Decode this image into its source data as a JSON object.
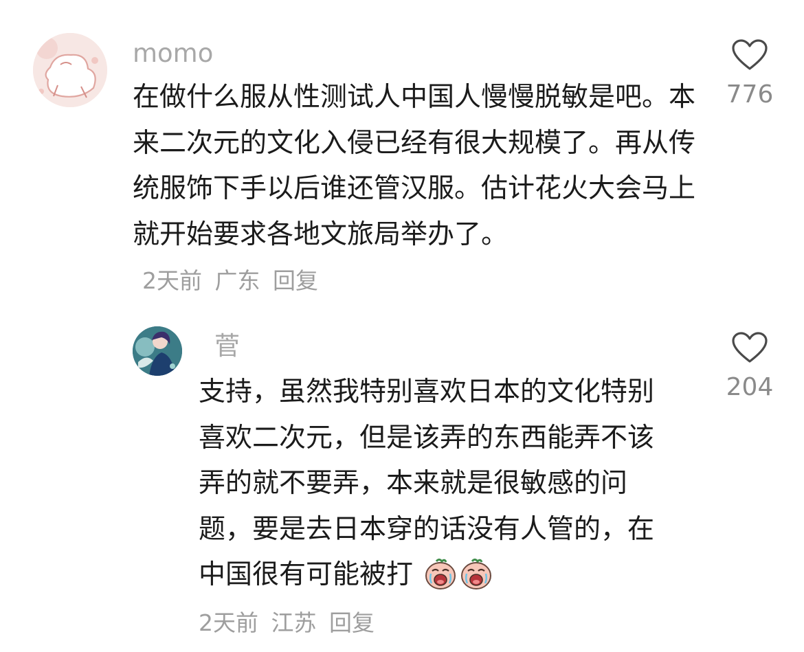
{
  "comments": [
    {
      "username": "momo",
      "text": "在做什么服从性测试人中国人慢慢脱敏是吧。本来二次元的文化入侵已经有很大规模了。再从传统服饰下手以后谁还管汉服。估计花火大会马上就开始要求各地文旅局举办了。",
      "time": "2天前",
      "location": "广东",
      "reply_label": "回复",
      "likes": "776",
      "avatar_icon": "pink-sketch-avatar-icon"
    },
    {
      "username": "菅",
      "text": "支持，虽然我特别喜欢日本的文化特别喜欢二次元，但是该弄的东西能弄不该弄的就不要弄，本来就是很敏感的问题，要是去日本穿的话没有人管的，在中国很有可能被打",
      "emojis": [
        "crying-face-emoji",
        "crying-face-emoji"
      ],
      "time": "2天前",
      "location": "江苏",
      "reply_label": "回复",
      "likes": "204",
      "avatar_icon": "anime-character-avatar-icon"
    }
  ],
  "icons": {
    "like": "heart-outline-icon"
  },
  "colors": {
    "meta_gray": "#9e9e9e",
    "username_gray": "#a8a8a8",
    "text": "#1b1b1b"
  }
}
